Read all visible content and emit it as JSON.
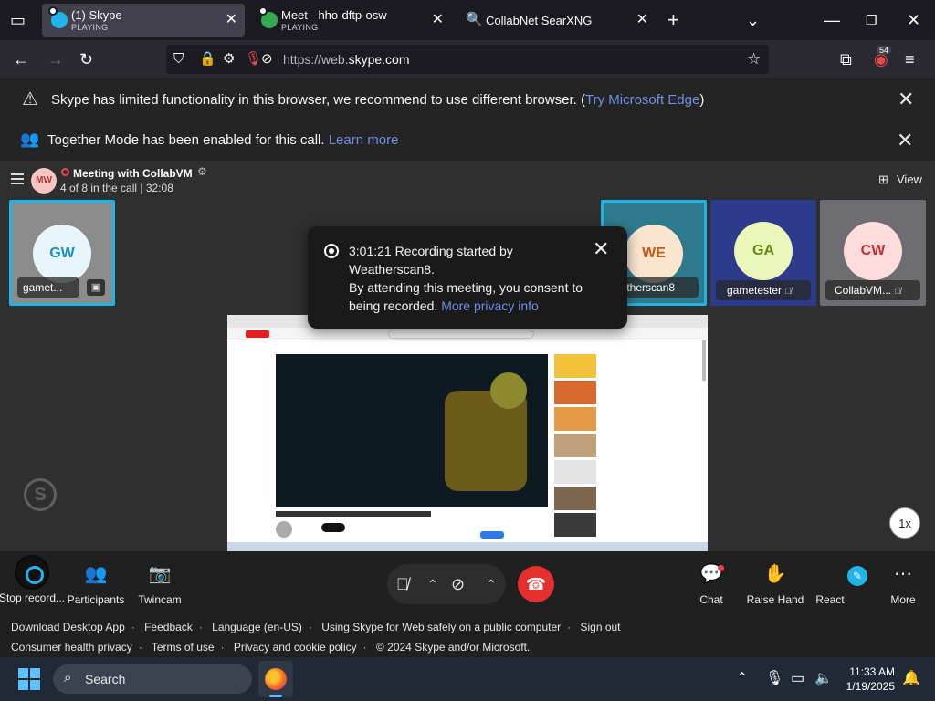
{
  "browser": {
    "tabs": [
      {
        "title": "(1) Skype",
        "sub": "PLAYING",
        "active": true
      },
      {
        "title": "Meet - hho-dftp-osw",
        "sub": "PLAYING",
        "active": false
      },
      {
        "title": "CollabNet SearXNG",
        "sub": "",
        "active": false
      }
    ],
    "new_tab": "+",
    "url_prefix": "https://web.",
    "url_domain": "skype.com",
    "extensions_badge": "54"
  },
  "banners": {
    "limited": {
      "text": "Skype has limited functionality in this browser, we recommend to use different browser. (",
      "link": "Try Microsoft Edge",
      "suffix": ")"
    },
    "together": {
      "text": "Together Mode has been enabled for this call.",
      "link": "Learn more"
    }
  },
  "call": {
    "avatar_initials": "MW",
    "title": "Meeting with CollabVM",
    "status": "4 of 8 in the call | 32:08",
    "view_label": "View",
    "participants": [
      {
        "initials": "GW",
        "name": "gamet...",
        "avatar_bg": "#e8f6fb",
        "avatar_fg": "#1a8fb8",
        "selected": true
      },
      {
        "initials": "WE",
        "name": "eatherscan8",
        "avatar_bg": "#fbe5cf",
        "avatar_fg": "#c25a18",
        "selected": true
      },
      {
        "initials": "GA",
        "name": "gametester",
        "avatar_bg": "#eaf7b8",
        "avatar_fg": "#5f8a12",
        "selected": false
      },
      {
        "initials": "CW",
        "name": "CollabVM...",
        "avatar_bg": "#fcdcdc",
        "avatar_fg": "#c53030",
        "selected": false
      }
    ],
    "speed": "1x",
    "skype_watermark": "S"
  },
  "toast": {
    "line1": "3:01:21 Recording started by Weatherscan8.",
    "line2": "By attending this meeting, you consent to being recorded.",
    "link": "More privacy info"
  },
  "controls": {
    "stop_recording": "Stop record...",
    "participants": "Participants",
    "twincam": "Twincam",
    "chat": "Chat",
    "raise_hand": "Raise Hand",
    "react": "React",
    "more": "More"
  },
  "footer": {
    "row1": [
      "Download Desktop App",
      "Feedback",
      "Language (en-US)",
      "Using Skype for Web safely on a public computer",
      "Sign out"
    ],
    "row2": [
      "Consumer health privacy",
      "Terms of use",
      "Privacy and cookie policy",
      "© 2024 Skype and/or Microsoft."
    ]
  },
  "taskbar": {
    "search_placeholder": "Search",
    "time": "11:33 AM",
    "date": "1/19/2025"
  },
  "colors": {
    "accent": "#1fb5ea",
    "link": "#6f8fe6",
    "end_call": "#e52e2e"
  }
}
